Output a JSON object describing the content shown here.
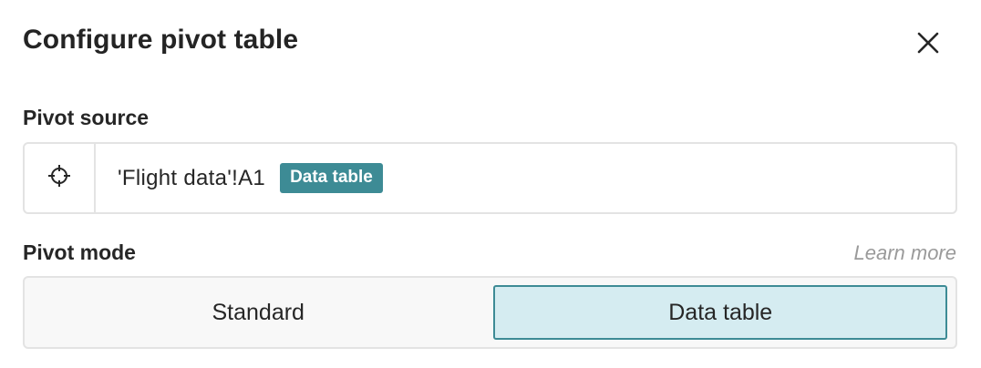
{
  "dialog": {
    "title": "Configure pivot table",
    "close_icon": "close-icon"
  },
  "pivot_source": {
    "label": "Pivot source",
    "target_icon": "crosshair-icon",
    "reference": "'Flight data'!A1",
    "badge": "Data table",
    "badge_color": "#3d8b95"
  },
  "pivot_mode": {
    "label": "Pivot mode",
    "learn_more": "Learn more",
    "options": [
      "Standard",
      "Data table"
    ],
    "selected": "Data table",
    "selected_bg": "#d5ecf1",
    "selected_border": "#3d8b95"
  }
}
